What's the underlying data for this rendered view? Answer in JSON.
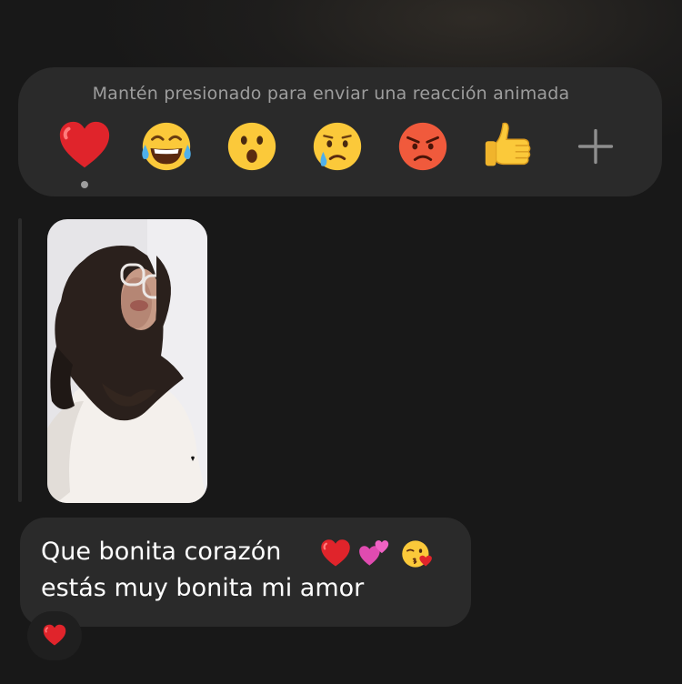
{
  "reaction_bar": {
    "hint": "Mantén presionado para enviar una reacción animada",
    "reactions": [
      {
        "name": "red-heart",
        "selected": true
      },
      {
        "name": "tears-of-joy"
      },
      {
        "name": "surprised"
      },
      {
        "name": "crying"
      },
      {
        "name": "angry"
      },
      {
        "name": "thumbs-up"
      },
      {
        "name": "add-more"
      }
    ]
  },
  "message": {
    "line1": "Que bonita corazón",
    "line2": "estás muy bonita mi amor",
    "reaction_badge": "red-heart"
  }
}
